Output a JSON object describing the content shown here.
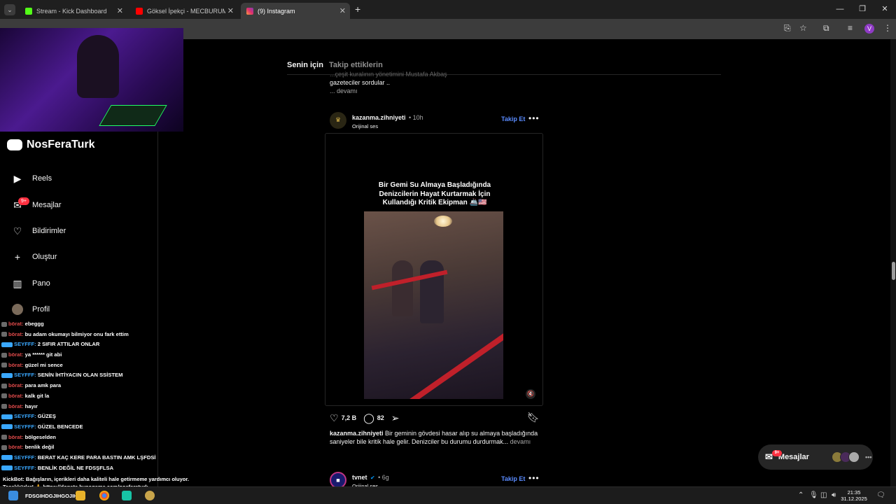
{
  "browser": {
    "tabs": [
      {
        "label": "Stream - Kick Dashboard",
        "favicon_color": "#53fc18",
        "active": false
      },
      {
        "label": "Göksel İpekçi - MECBURUM (O",
        "favicon_color": "#ff0000",
        "active": false
      },
      {
        "label": "(9) Instagram",
        "favicon_color": "#e1306c",
        "active": true
      }
    ],
    "new_tab_symbol": "+",
    "profile_initial": "V"
  },
  "overlay": {
    "discord_name": "NosFeraTurk"
  },
  "sidebar": {
    "items": [
      {
        "label": "Reels",
        "icon": "reels-icon"
      },
      {
        "label": "Mesajlar",
        "icon": "messenger-icon",
        "badge": "9+"
      },
      {
        "label": "Bildirimler",
        "icon": "heart-icon"
      },
      {
        "label": "Oluştur",
        "icon": "plus-icon"
      },
      {
        "label": "Pano",
        "icon": "dashboard-icon"
      },
      {
        "label": "Profil",
        "icon": "profile-avatar"
      }
    ]
  },
  "chat": {
    "lines": [
      {
        "user": "börat:",
        "text": "ebeggg",
        "style": "u1"
      },
      {
        "user": "börat:",
        "text": "bu adam okumayı bilmiyor onu fark ettim",
        "style": "u1"
      },
      {
        "user": "SEYFFF:",
        "text": "2 SIFIR ATTILAR ONLAR",
        "style": "u2"
      },
      {
        "user": "börat:",
        "text": "ya ****** git abi",
        "style": "u1"
      },
      {
        "user": "börat:",
        "text": "güzel mi sence",
        "style": "u1"
      },
      {
        "user": "SEYFFF:",
        "text": "SENİN İHTİYACIN OLAN SSİSTEM",
        "style": "u2"
      },
      {
        "user": "börat:",
        "text": "para amk para",
        "style": "u1"
      },
      {
        "user": "börat:",
        "text": "kalk git la",
        "style": "u1"
      },
      {
        "user": "börat:",
        "text": "hayır",
        "style": "u1"
      },
      {
        "user": "SEYFFF:",
        "text": "GÜZEŞ",
        "style": "u2"
      },
      {
        "user": "SEYFFF:",
        "text": "GÜZEL BENCEDE",
        "style": "u2"
      },
      {
        "user": "börat:",
        "text": "bölgeselden",
        "style": "u1"
      },
      {
        "user": "börat:",
        "text": "benlik değil",
        "style": "u1"
      },
      {
        "user": "SEYFFF:",
        "text": "BERAT KAÇ KERE PARA BASTIN AMK LŞFDSİ",
        "style": "u2"
      },
      {
        "user": "SEYFFF:",
        "text": "BENLİK DEĞİL NE FDSŞFLSA",
        "style": "u2"
      }
    ],
    "donate_line_1": "KickBot: Bağışların, içerikleri daha kaliteli hale getirmeme yardımcı oluyor.",
    "donate_line_2": "Teşekkürler! 🙏 https://donate.bynogame.com/nosferaturk",
    "last_line": "FDSGIHDGJIHGOJIHGB"
  },
  "feed": {
    "tab_for_you": "Senin için",
    "tab_following": "Takip ettiklerin",
    "prev_caption_line1": "...çeşit kuralının yönetimini Mustafa Akbaş",
    "prev_caption_line2": "gazeteciler sordular ..",
    "prev_more": "... devamı",
    "post": {
      "username": "kazanma.zihniyeti",
      "time": "• 10h",
      "audio": "Orijinal ses",
      "follow": "Takip Et",
      "video_title_1": "Bir Gemi Su Almaya Başladığında",
      "video_title_2": "Denizcilerin Hayat Kurtarmak İçin",
      "video_title_3": "Kullandığı Kritik Ekipman 🚢🇺🇸",
      "likes": "7,2 B",
      "comments": "82",
      "caption_user": "kazanma.zihniyeti",
      "caption_text": "Bir geminin gövdesi hasar alıp su almaya başladığında saniyeler bile kritik hale gelir. Denizciler bu durumu durdurmak...",
      "caption_more": "devamı"
    },
    "next_post": {
      "username": "tvnet",
      "verified": "✔",
      "time": "• 6g",
      "audio": "Orijinal ses",
      "follow": "Takip Et"
    }
  },
  "messages_pill": {
    "label": "Mesajlar",
    "badge": "9+"
  },
  "taskbar": {
    "time": "21:35",
    "date": "31.12.2025"
  },
  "colors": {
    "accent_blue": "#5a8bff",
    "badge_red": "#ff3040"
  }
}
